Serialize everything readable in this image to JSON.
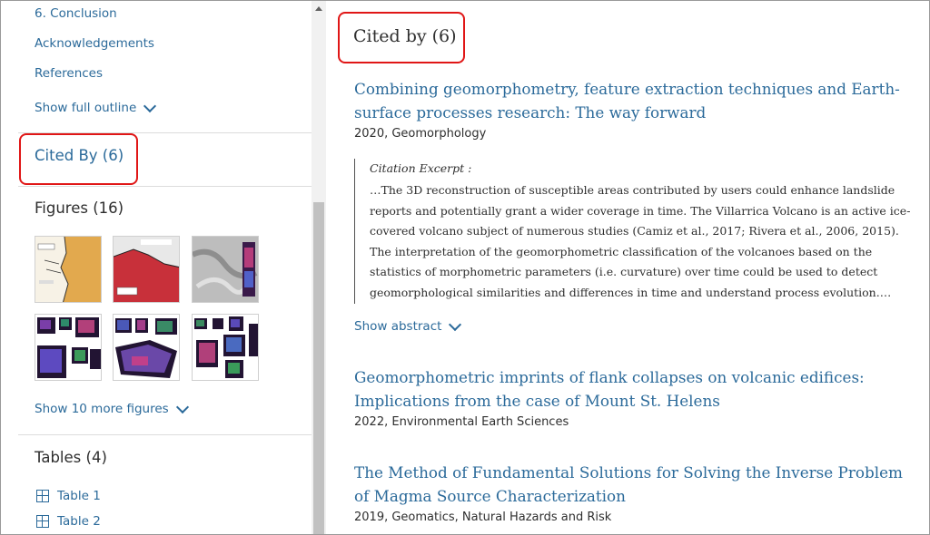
{
  "sidebar": {
    "outline_links": [
      "6. Conclusion",
      "Acknowledgements",
      "References"
    ],
    "show_outline": "Show full outline",
    "cited_by": "Cited By (6)",
    "figures_title": "Figures (16)",
    "show_more_figures": "Show 10 more figures",
    "tables_title": "Tables (4)",
    "tables": [
      "Table 1",
      "Table 2"
    ]
  },
  "main": {
    "heading": "Cited by (6)",
    "articles": [
      {
        "title": "Combining geomorphometry, feature extraction techniques and Earth-surface processes research: The way forward",
        "meta": "2020, Geomorphology"
      },
      {
        "title": "Geomorphometric imprints of flank collapses on volcanic edifices: Implications from the case of Mount St. Helens",
        "meta": "2022, Environmental Earth Sciences"
      },
      {
        "title": "The Method of Fundamental Solutions for Solving the Inverse Problem of Magma Source Characterization",
        "meta": "2019, Geomatics, Natural Hazards and Risk"
      }
    ],
    "excerpt": {
      "label": "Citation Excerpt :",
      "text": "…The 3D reconstruction of susceptible areas contributed by users could enhance landslide reports and potentially grant a wider coverage in time. The Villarrica Volcano is an active ice-covered volcano subject of numerous studies (Camiz et al., 2017; Rivera et al., 2006, 2015). The interpretation of the geomorphometric classification of the volcanoes based on the statistics of morphometric parameters (i.e. curvature) over time could be used to detect geomorphological similarities and differences in time and understand process evolution.…"
    },
    "show_abstract": "Show abstract"
  },
  "colors": {
    "link": "#2b6a9a",
    "highlight_box": "#e01616",
    "text": "#2e2e2e"
  }
}
